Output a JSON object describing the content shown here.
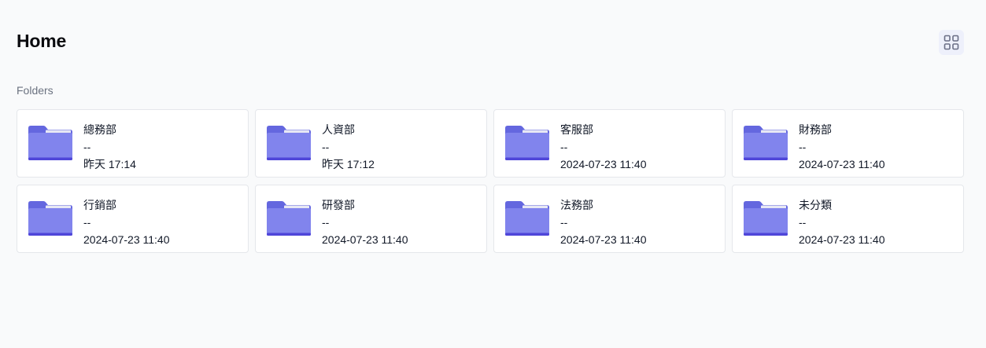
{
  "header": {
    "title": "Home"
  },
  "section": {
    "label": "Folders"
  },
  "icons": {
    "folder": "folder-icon",
    "view_toggle": "grid-view-icon"
  },
  "colors": {
    "folder_body": "#8184ed",
    "folder_back": "#6467df",
    "folder_bottom": "#4f46d9",
    "folder_paper": "#e7e8f4",
    "toggle_bg": "#eef0fb",
    "toggle_icon": "#6b6f86"
  },
  "folders": [
    {
      "name": "總務部",
      "size": "--",
      "modified": "昨天 17:14"
    },
    {
      "name": "人資部",
      "size": "--",
      "modified": "昨天 17:12"
    },
    {
      "name": "客服部",
      "size": "--",
      "modified": "2024-07-23 11:40"
    },
    {
      "name": "財務部",
      "size": "--",
      "modified": "2024-07-23 11:40"
    },
    {
      "name": "行銷部",
      "size": "--",
      "modified": "2024-07-23 11:40"
    },
    {
      "name": "研發部",
      "size": "--",
      "modified": "2024-07-23 11:40"
    },
    {
      "name": "法務部",
      "size": "--",
      "modified": "2024-07-23 11:40"
    },
    {
      "name": "未分類",
      "size": "--",
      "modified": "2024-07-23 11:40"
    }
  ]
}
